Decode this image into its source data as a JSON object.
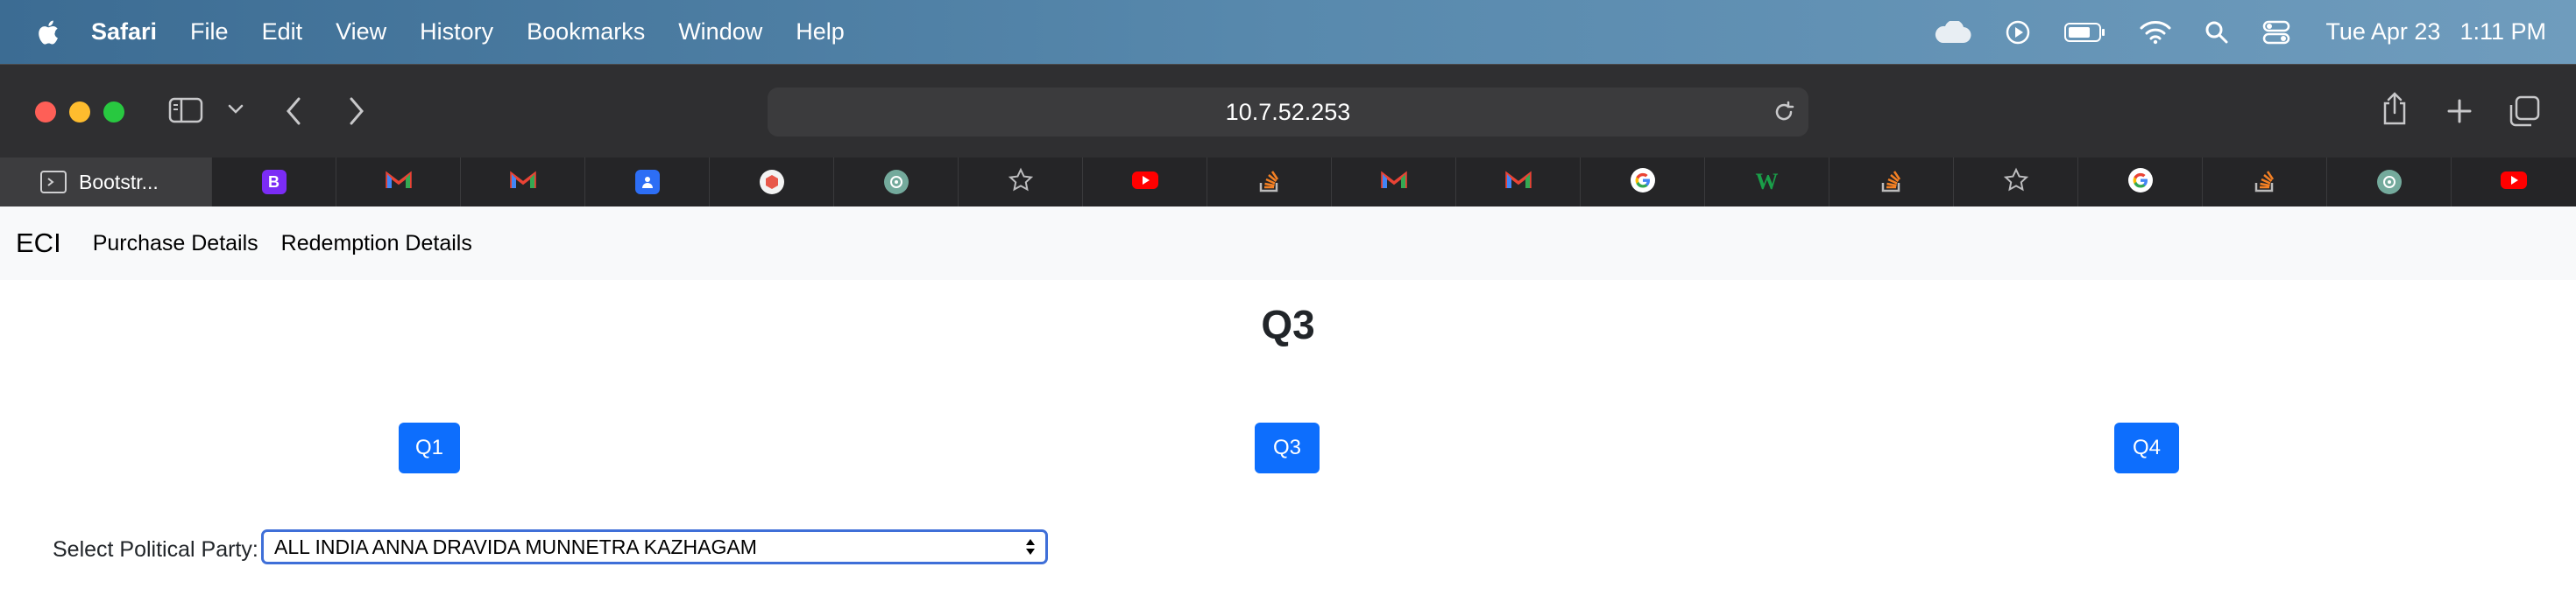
{
  "menubar": {
    "items": [
      "Safari",
      "File",
      "Edit",
      "View",
      "History",
      "Bookmarks",
      "Window",
      "Help"
    ],
    "status": {
      "date": "Tue Apr 23",
      "time": "1:11 PM"
    }
  },
  "browser": {
    "url": "10.7.52.253",
    "active_tab_title": "Bootstr...",
    "tab_icons": [
      "terminal-icon",
      "bootstrap-icon",
      "gmail-icon",
      "gmail-icon",
      "contacts-icon",
      "cube-icon",
      "chatgpt-icon",
      "star-icon",
      "youtube-icon",
      "stackoverflow-icon",
      "gmail-icon",
      "gmail-icon",
      "google-icon",
      "w-icon",
      "stackoverflow-icon",
      "star-icon",
      "google-icon",
      "stackoverflow-icon",
      "chatgpt-icon",
      "youtube-icon"
    ]
  },
  "page": {
    "navbar": {
      "brand": "ECI",
      "links": [
        "Purchase Details",
        "Redemption Details"
      ]
    },
    "heading": "Q3",
    "quarter_buttons": [
      "Q1",
      "Q3",
      "Q4"
    ],
    "party_label": "Select Political Party:",
    "party_selected": "ALL INDIA ANNA DRAVIDA MUNNETRA KAZHAGAM"
  },
  "colors": {
    "primary_button": "#0d6efd",
    "navbar_bg": "#f8f9fa",
    "toolbar_bg": "#2f2f31",
    "select_focus": "#3f6fd8"
  }
}
